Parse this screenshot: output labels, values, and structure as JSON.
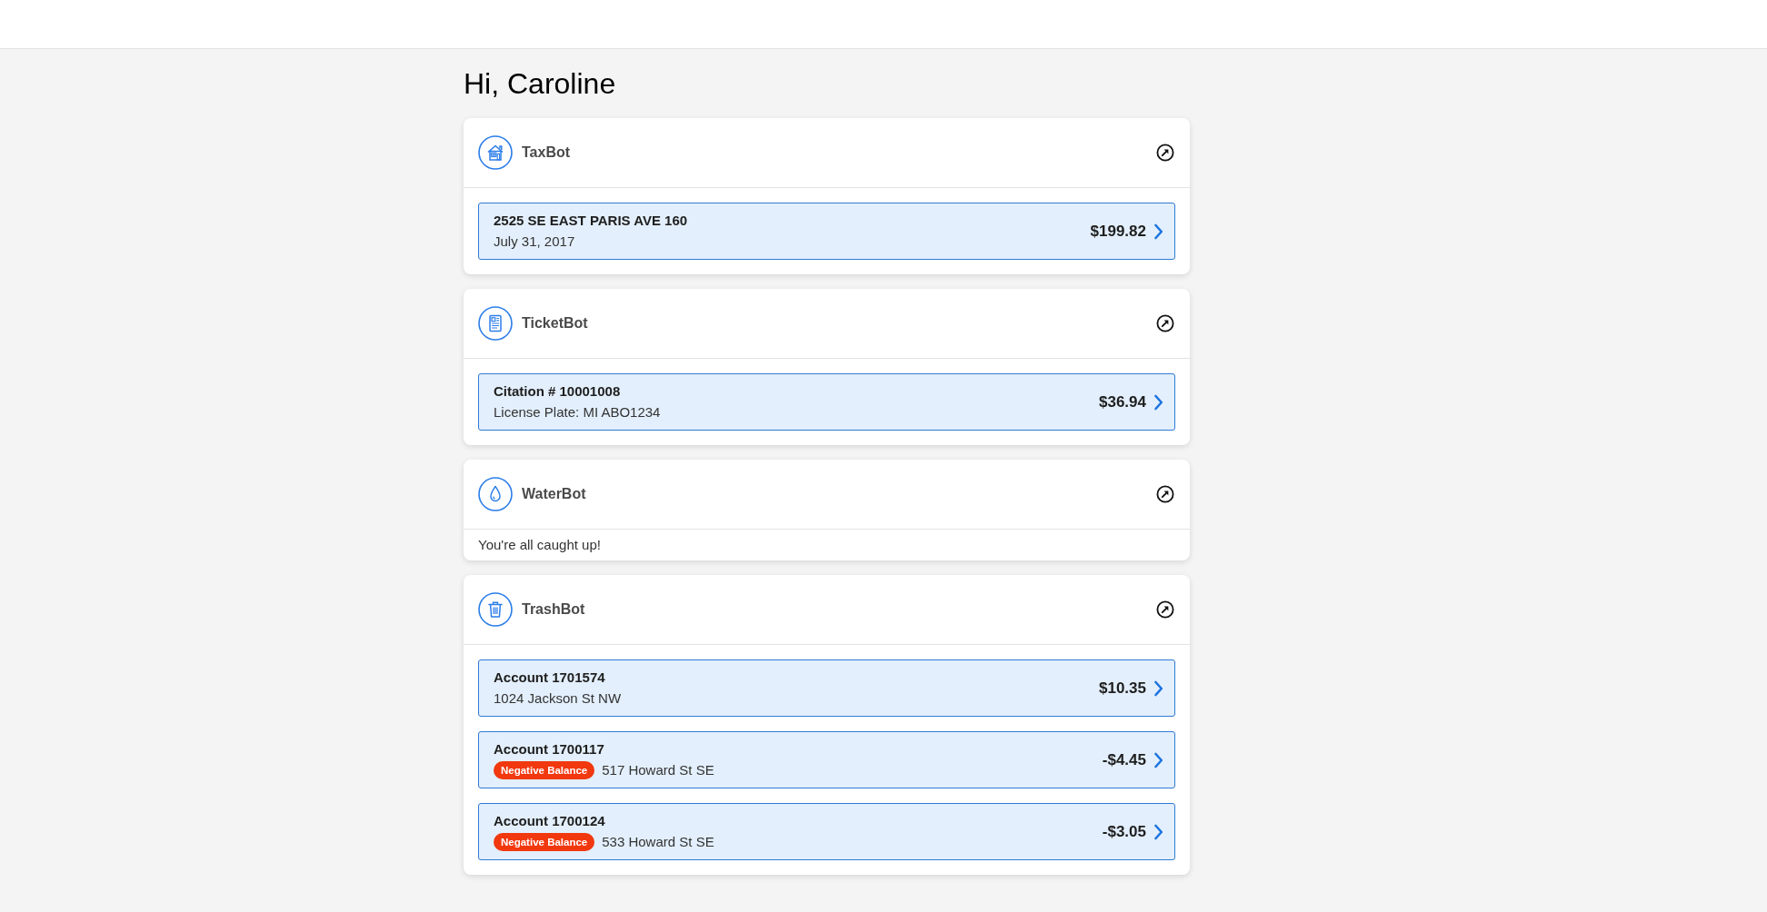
{
  "greeting": "Hi, Caroline",
  "bots": [
    {
      "kind": "tax",
      "name": "TaxBot",
      "items": [
        {
          "title": "2525 SE EAST PARIS AVE 160",
          "subtitle": "July 31, 2017",
          "amount": "$199.82"
        }
      ]
    },
    {
      "kind": "ticket",
      "name": "TicketBot",
      "items": [
        {
          "title": "Citation # 10001008",
          "subtitle": "License Plate: MI ABO1234",
          "amount": "$36.94"
        }
      ]
    },
    {
      "kind": "water",
      "name": "WaterBot",
      "message": "You're all caught up!"
    },
    {
      "kind": "trash",
      "name": "TrashBot",
      "items": [
        {
          "title": "Account 1701574",
          "subtitle": "1024 Jackson St NW",
          "amount": "$10.35"
        },
        {
          "title": "Account 1700117",
          "badge": "Negative Balance",
          "subtitle": "517 Howard St SE",
          "amount": "-$4.45"
        },
        {
          "title": "Account 1700124",
          "badge": "Negative Balance",
          "subtitle": "533 Howard St SE",
          "amount": "-$3.05"
        }
      ]
    }
  ]
}
